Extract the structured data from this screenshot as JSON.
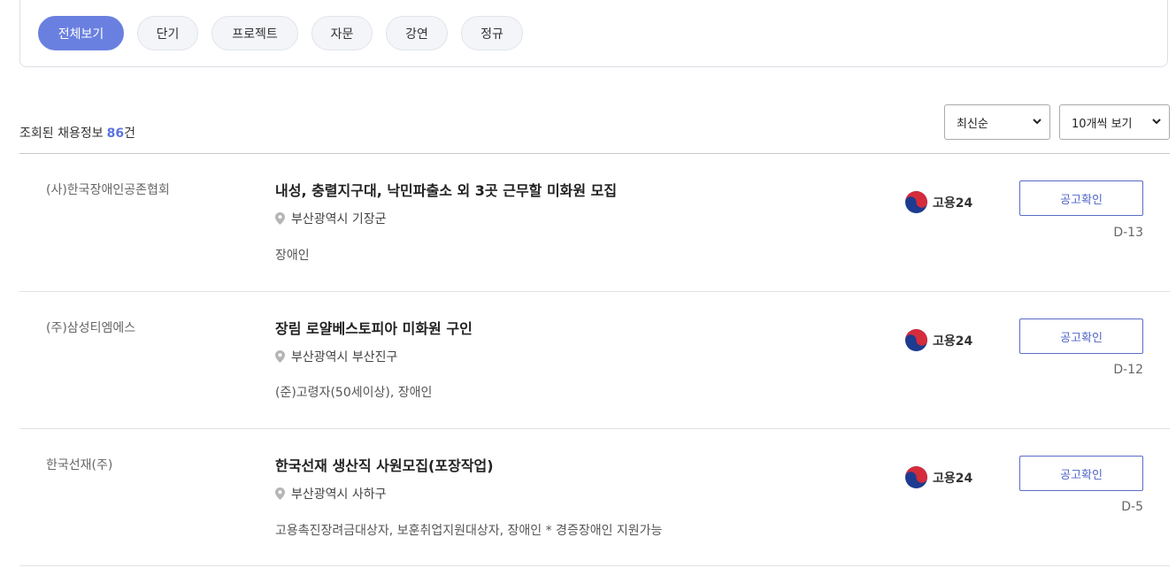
{
  "filters": {
    "tabs": [
      "전체보기",
      "단기",
      "프로젝트",
      "자문",
      "강연",
      "정규"
    ],
    "active_index": 0
  },
  "summary": {
    "prefix": "조회된 채용정보",
    "count": "86",
    "suffix": "건"
  },
  "sort_select": {
    "value": "최신순"
  },
  "page_size_select": {
    "value": "10개씩 보기"
  },
  "jobs": [
    {
      "company": "(사)한국장애인공존협회",
      "title": "내성, 충렬지구대, 낙민파출소 외 3곳 근무할 미화원 모집",
      "location": "부산광역시 기장군",
      "tags": "장애인",
      "source": "고용24",
      "button": "공고확인",
      "dday": "D-13"
    },
    {
      "company": "(주)삼성티엠에스",
      "title": "장림 로얄베스토피아 미화원 구인",
      "location": "부산광역시 부산진구",
      "tags": "(준)고령자(50세이상), 장애인",
      "source": "고용24",
      "button": "공고확인",
      "dday": "D-12"
    },
    {
      "company": "한국선재(주)",
      "title": "한국선재 생산직 사원모집(포장작업)",
      "location": "부산광역시 사하구",
      "tags": "고용촉진장려금대상자, 보훈취업지원대상자, 장애인 * 경증장애인 지원가능",
      "source": "고용24",
      "button": "공고확인",
      "dday": "D-5"
    }
  ],
  "colors": {
    "accent": "#6a80e0",
    "count": "#5b73e0",
    "button_border": "#5b6cc8"
  },
  "icons": {
    "location": "map-pin-icon",
    "source_logo": "taegeuk-icon",
    "select": "chevron-down-icon"
  }
}
